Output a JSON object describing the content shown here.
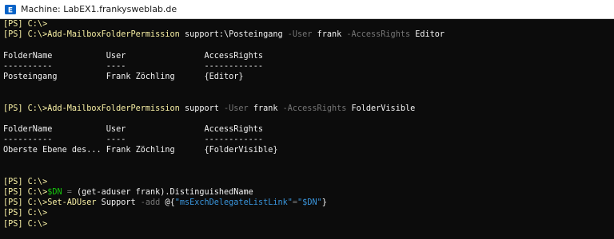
{
  "window": {
    "title": "Machine: LabEX1.frankysweblab.de",
    "icon": "exchange-icon",
    "icon_color": "#0a64c8"
  },
  "terminal": {
    "lines": [
      {
        "kind": "prompt",
        "segments": [
          {
            "text": "[PS] C:\\>",
            "c": "yellow"
          }
        ]
      },
      {
        "kind": "prompt",
        "segments": [
          {
            "text": "[PS] C:\\>",
            "c": "yellow"
          },
          {
            "text": "Add-MailboxFolderPermission",
            "c": "yellow"
          },
          {
            "text": " support:\\Posteingang ",
            "c": "white"
          },
          {
            "text": "-User",
            "c": "gray"
          },
          {
            "text": " frank ",
            "c": "white"
          },
          {
            "text": "-AccessRights",
            "c": "gray"
          },
          {
            "text": " Editor",
            "c": "white"
          }
        ]
      },
      {
        "kind": "blank",
        "segments": []
      },
      {
        "kind": "output",
        "segments": [
          {
            "text": "FolderName           User                AccessRights",
            "c": "white"
          }
        ]
      },
      {
        "kind": "output",
        "segments": [
          {
            "text": "----------           ----                ------------",
            "c": "white"
          }
        ]
      },
      {
        "kind": "output",
        "segments": [
          {
            "text": "Posteingang          Frank Zöchling      {Editor}",
            "c": "white"
          }
        ]
      },
      {
        "kind": "blank",
        "segments": []
      },
      {
        "kind": "blank",
        "segments": []
      },
      {
        "kind": "prompt",
        "segments": [
          {
            "text": "[PS] C:\\>",
            "c": "yellow"
          },
          {
            "text": "Add-MailboxFolderPermission",
            "c": "yellow"
          },
          {
            "text": " support ",
            "c": "white"
          },
          {
            "text": "-User",
            "c": "gray"
          },
          {
            "text": " frank ",
            "c": "white"
          },
          {
            "text": "-AccessRights",
            "c": "gray"
          },
          {
            "text": " FolderVisible",
            "c": "white"
          }
        ]
      },
      {
        "kind": "blank",
        "segments": []
      },
      {
        "kind": "output",
        "segments": [
          {
            "text": "FolderName           User                AccessRights",
            "c": "white"
          }
        ]
      },
      {
        "kind": "output",
        "segments": [
          {
            "text": "----------           ----                ------------",
            "c": "white"
          }
        ]
      },
      {
        "kind": "output",
        "segments": [
          {
            "text": "Oberste Ebene des... Frank Zöchling      {FolderVisible}",
            "c": "white"
          }
        ]
      },
      {
        "kind": "blank",
        "segments": []
      },
      {
        "kind": "blank",
        "segments": []
      },
      {
        "kind": "prompt",
        "segments": [
          {
            "text": "[PS] C:\\>",
            "c": "yellow"
          }
        ]
      },
      {
        "kind": "prompt",
        "segments": [
          {
            "text": "[PS] C:\\>",
            "c": "yellow"
          },
          {
            "text": "$DN",
            "c": "green"
          },
          {
            "text": " = ",
            "c": "gray"
          },
          {
            "text": "(get-aduser frank).DistinguishedName",
            "c": "white"
          }
        ]
      },
      {
        "kind": "prompt",
        "segments": [
          {
            "text": "[PS] C:\\>",
            "c": "yellow"
          },
          {
            "text": "Set-ADUser",
            "c": "yellow"
          },
          {
            "text": " Support ",
            "c": "white"
          },
          {
            "text": "-add",
            "c": "gray"
          },
          {
            "text": " @{",
            "c": "white"
          },
          {
            "text": "\"msExchDelegateListLink\"",
            "c": "cyan"
          },
          {
            "text": "=",
            "c": "gray"
          },
          {
            "text": "\"$DN\"",
            "c": "cyan"
          },
          {
            "text": "}",
            "c": "white"
          }
        ]
      },
      {
        "kind": "prompt",
        "segments": [
          {
            "text": "[PS] C:\\>",
            "c": "yellow"
          }
        ]
      },
      {
        "kind": "prompt",
        "segments": [
          {
            "text": "[PS] C:\\>",
            "c": "yellow"
          }
        ]
      }
    ]
  }
}
